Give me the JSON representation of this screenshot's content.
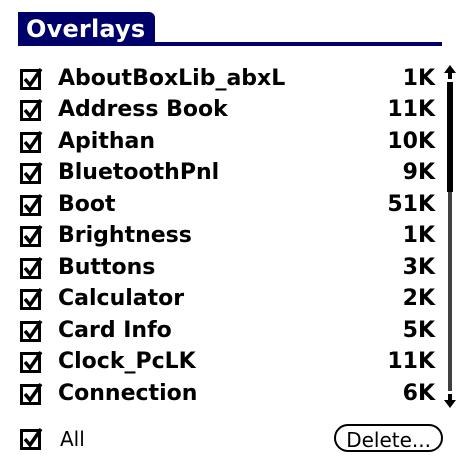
{
  "title": "Overlays",
  "items": [
    {
      "name": "AboutBoxLib_abxL",
      "size": "1K",
      "checked": true
    },
    {
      "name": "Address Book",
      "size": "11K",
      "checked": true
    },
    {
      "name": "Apithan",
      "size": "10K",
      "checked": true
    },
    {
      "name": "BluetoothPnl",
      "size": "9K",
      "checked": true
    },
    {
      "name": "Boot",
      "size": "51K",
      "checked": true
    },
    {
      "name": "Brightness",
      "size": "1K",
      "checked": true
    },
    {
      "name": "Buttons",
      "size": "3K",
      "checked": true
    },
    {
      "name": "Calculator",
      "size": "2K",
      "checked": true
    },
    {
      "name": "Card Info",
      "size": "5K",
      "checked": true
    },
    {
      "name": "Clock_PcLK",
      "size": "11K",
      "checked": true
    },
    {
      "name": "Connection",
      "size": "6K",
      "checked": true
    }
  ],
  "footer": {
    "all_label": "All",
    "all_checked": true,
    "delete_label": "Delete..."
  },
  "colors": {
    "title_bg": "#00006b",
    "title_fg": "#ffffff",
    "text": "#000000"
  },
  "icons": {
    "checkbox": "checked-checkbox-icon",
    "scroll_up": "scroll-up-arrow-icon",
    "scroll_down": "scroll-down-arrow-icon"
  }
}
